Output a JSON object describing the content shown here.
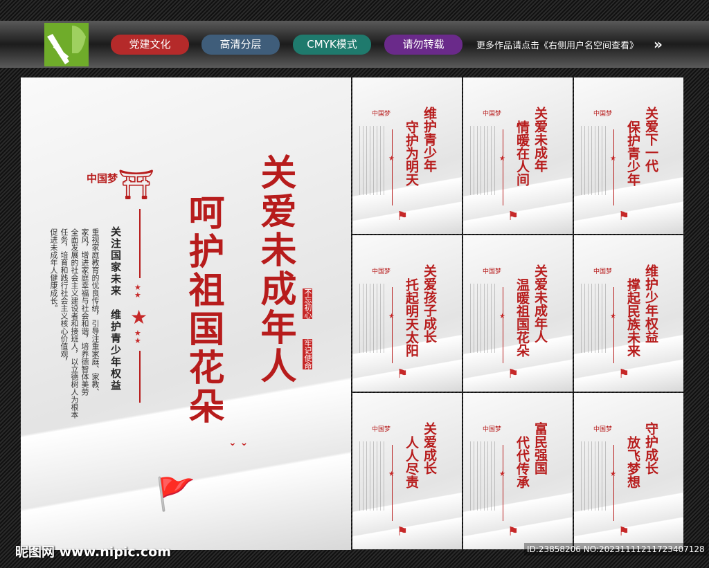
{
  "header": {
    "tags": [
      {
        "label": "党建文化",
        "color": "#b52a2a"
      },
      {
        "label": "高清分层",
        "color": "#3f5d7a"
      },
      {
        "label": "CMYK模式",
        "color": "#1f7a6d"
      },
      {
        "label": "请勿转载",
        "color": "#6a2a8a"
      }
    ],
    "more_text": "更多作品请点击《右侧用户名空间查看》",
    "arrow_icon": "double-chevron-right-icon"
  },
  "main_poster": {
    "title_line1": "关爱未成年人",
    "title_line2": "呵护祖国花朵",
    "logo_text": "中国梦",
    "subtitle_line1": "关注国家未来",
    "subtitle_line2": "维护青少年权益",
    "body_lines": [
      "重视家庭教育的优良传统，引导注重家庭、家教、",
      "家风，增进家庭幸福与社会和谐，培养德智体美劳",
      "全面发展的社会主义建设者和接班人，以立德树人为根本",
      "任务，培育和践行社会主义核心价值观，",
      "促进未成年人健康成长。"
    ],
    "seal_1": "不忘初心",
    "seal_2": "牢记使命"
  },
  "mini_posters": [
    {
      "line1": "维护青少年",
      "line2": "守护为明天"
    },
    {
      "line1": "关爱未成年",
      "line2": "情暖在人间"
    },
    {
      "line1": "关爱下一代",
      "line2": "保护青少年"
    },
    {
      "line1": "关爱孩子成长",
      "line2": "托起明天太阳"
    },
    {
      "line1": "关爱未成年人",
      "line2": "温暖祖国花朵"
    },
    {
      "line1": "维护少年权益",
      "line2": "撑起民族未来"
    },
    {
      "line1": "关爱成长",
      "line2": "人人尽责"
    },
    {
      "line1": "富民强国",
      "line2": "代代传承"
    },
    {
      "line1": "守护成长",
      "line2": "放飞梦想"
    }
  ],
  "watermark": "昵图网 www.nipic.com",
  "image_id": "ID:23858206 NO:20231111211723407128"
}
